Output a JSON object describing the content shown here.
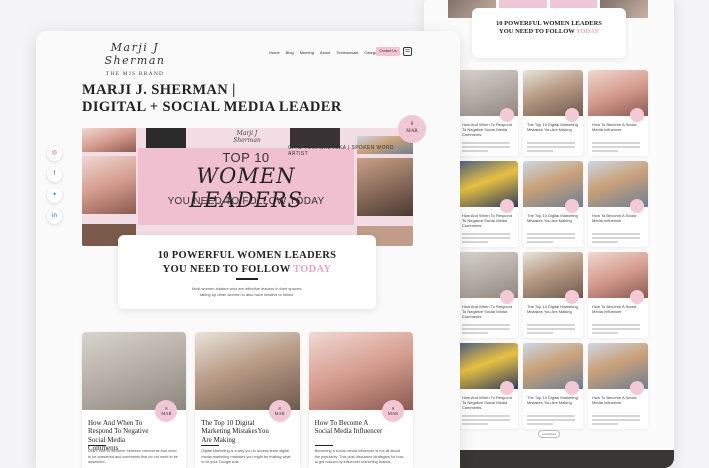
{
  "site": {
    "logo_script": "Marji J Sherman",
    "logo_sub": "THE MJS BRAND"
  },
  "nav": {
    "items": [
      "Home",
      "Blog",
      "Meeting",
      "About",
      "Testimonials",
      "Categories"
    ],
    "contact_label": "Contact Us",
    "menu_icon": "☰"
  },
  "page_title": "MARJI J. SHERMAN |\nDIGITAL + SOCIAL MEDIA LEADER",
  "social_icons": [
    "instagram-icon",
    "facebook-icon",
    "twitter-icon",
    "linkedin-icon"
  ],
  "hero": {
    "brand_logo": "Marji J Sherman",
    "top_line": "TOP 10",
    "script_line": "WOMEN LEADERS",
    "bottom_line": "YOU NEED TO FOLLOW TODAY",
    "caption": "OPAL TOMASHEVSKA | SPOKEN WORD ARTIST",
    "date_day": "8",
    "date_month": "MAR"
  },
  "headline": {
    "line1_num": "10",
    "line1_rest": "POWERFUL WOMEN LEADERS",
    "line2": "YOU NEED TO FOLLOW",
    "line2_pink": "TODAY",
    "description": "Most women leaders who are effective leaders in their spaces, taking up other women to also have leaders to follow."
  },
  "posts": [
    {
      "title": "How And When To Respond To Negative Social Media Comments",
      "date_day": "8",
      "date_month": "MAR",
      "excerpt": "Learn how to decipher between comments that need to be answered and comments that do not need to be answered."
    },
    {
      "title": "The Top 10 Digital Marketing MistakesYou Are Making",
      "date_day": "8",
      "date_month": "MAR",
      "excerpt": "Digital Marketing is a way you to access learn digital media marketing mistakes you might be making what to fix your Google Ads."
    },
    {
      "title": "How To Become A Social Media Influencer",
      "date_day": "8",
      "date_month": "MAR",
      "excerpt": "Becoming a social media influencer is not all about the popularity. This post discusses strategies for how to get noticed by influencer marketing brands."
    }
  ],
  "back_page": {
    "headline_line1": "10 POWERFUL WOMEN LEADERS",
    "headline_line2": "YOU NEED TO FOLLOW",
    "headline_pink": "TODAY",
    "grid": [
      {
        "title": "How And When To Respond To Negative Social Media Comments"
      },
      {
        "title": "The Top 10 Digital Marketing Mistakes You Are Making"
      },
      {
        "title": "How To Become A Social Media Influencer"
      },
      {
        "title": "How And When To Respond To Negative Social Media Comments"
      },
      {
        "title": "The Top 10 Digital Marketing Mistakes You Are Making"
      },
      {
        "title": "How To Become A Social Media Influencer"
      },
      {
        "title": "How And When To Respond To Negative Social Media Comments"
      },
      {
        "title": "The Top 10 Digital Marketing Mistakes You Are Making"
      },
      {
        "title": "How To Become A Social Media Influencer"
      },
      {
        "title": "How And When To Respond To Negative Social Media Comments"
      },
      {
        "title": "The Top 10 Digital Marketing Mistakes You Are Making"
      },
      {
        "title": "How To Become A Social Media Influencer"
      }
    ],
    "load_more": "Load More"
  },
  "colors": {
    "accent_pink": "#f2c7d5",
    "headline_pink": "#e7a6bd",
    "footer_dark": "#3a3633"
  }
}
